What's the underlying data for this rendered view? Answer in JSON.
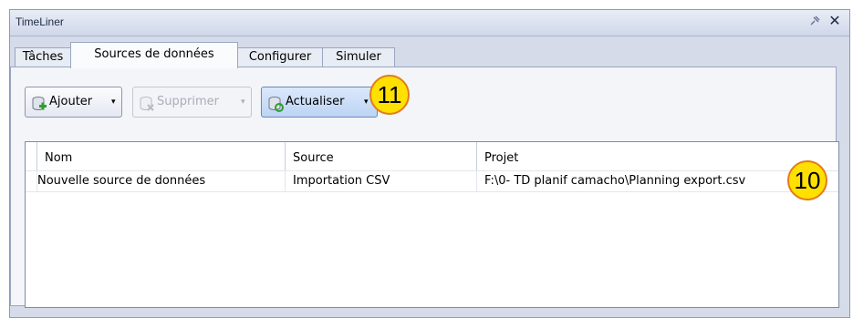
{
  "window": {
    "title": "TimeLiner",
    "pin_icon": "pin-icon",
    "close_icon": "close-icon"
  },
  "tabs": [
    {
      "label": "Tâches",
      "active": false
    },
    {
      "label": "Sources de données",
      "active": true
    },
    {
      "label": "Configurer",
      "active": false
    },
    {
      "label": "Simuler",
      "active": false
    }
  ],
  "toolbar": {
    "add_label": "Ajouter",
    "delete_label": "Supprimer",
    "refresh_label": "Actualiser",
    "caret": "▾"
  },
  "table": {
    "columns": [
      "Nom",
      "Source",
      "Projet"
    ],
    "rows": [
      [
        "Nouvelle source de données",
        "Importation CSV",
        "F:\\0- TD planif camacho\\Planning export.csv"
      ]
    ]
  },
  "callouts": {
    "refresh_marker": "11",
    "project_marker": "10"
  },
  "colors": {
    "callout_fill": "#ffe000",
    "callout_border": "#e27b1d"
  }
}
